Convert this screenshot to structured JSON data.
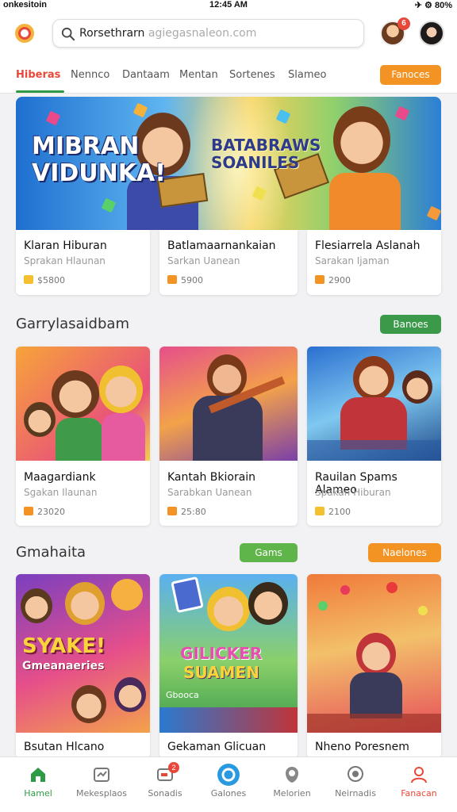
{
  "status_bar": {
    "carrier": "onkesitoin",
    "time": "12:45 AM",
    "icons": "✈ ⚙ 80%"
  },
  "header": {
    "search_query": "Rorsethrarn",
    "search_domain": "agiegasnaleon.com",
    "notification_count": "6"
  },
  "tabs": {
    "items": [
      "Hiberas",
      "Nennco",
      "Dantaam",
      "Mentan",
      "Sortenes",
      "Slameo"
    ],
    "cta": "Fanoces"
  },
  "banner": {
    "title_line1": "MIBRAN",
    "title_line2": "VIDUNKA!",
    "subtitle_line1": "BATABRAWS",
    "subtitle_line2": "SOANILES"
  },
  "featured": [
    {
      "title": "Klaran Hiburan",
      "subtitle": "Sprakan Hlaunan",
      "stat": "$5800"
    },
    {
      "title": "Batlamaarnankaian",
      "subtitle": "Sarkan Uanean",
      "stat": "5900"
    },
    {
      "title": "Flesiarrela Aslanah",
      "subtitle": "Sarakan Ijaman",
      "stat": "2900"
    }
  ],
  "section2": {
    "title": "Garrylasaidbam",
    "pill": "Banoes",
    "cards": [
      {
        "title": "Maagardiank",
        "subtitle": "Sgakan Ilaunan",
        "stat": "23020"
      },
      {
        "title": "Kantah Bkiorain",
        "subtitle": "Sarabkan Uanean",
        "stat": "25:80"
      },
      {
        "title": "Rauilan Spams Alameo",
        "subtitle": "Spakan Hiburan",
        "stat": "2100"
      }
    ]
  },
  "section3": {
    "title": "Gmahaita",
    "pill_a": "Gams",
    "pill_b": "Naelones",
    "cards": [
      {
        "title": "Bsutan Hlcano",
        "art_text1": "SYAKE!",
        "art_text2": "Gmeanaeries"
      },
      {
        "title": "Gekaman Glicuan",
        "art_text1": "GILICKER",
        "art_text2": "SUAMEN",
        "tag": "Gbooca"
      },
      {
        "title": "Nheno Poresnem"
      }
    ]
  },
  "bottom_nav": [
    {
      "label": "Hamel",
      "icon": "home-icon"
    },
    {
      "label": "Mekesplaos",
      "icon": "marketplace-icon"
    },
    {
      "label": "Sonadis",
      "icon": "inbox-icon",
      "badge": "2"
    },
    {
      "label": "Galones",
      "icon": "play-icon"
    },
    {
      "label": "Melorien",
      "icon": "shield-icon"
    },
    {
      "label": "Neirnadis",
      "icon": "chat-icon"
    },
    {
      "label": "Fanacan",
      "icon": "profile-icon"
    }
  ],
  "colors": {
    "accent": "#e8483a",
    "green": "#2e9a46",
    "orange": "#f39323"
  }
}
